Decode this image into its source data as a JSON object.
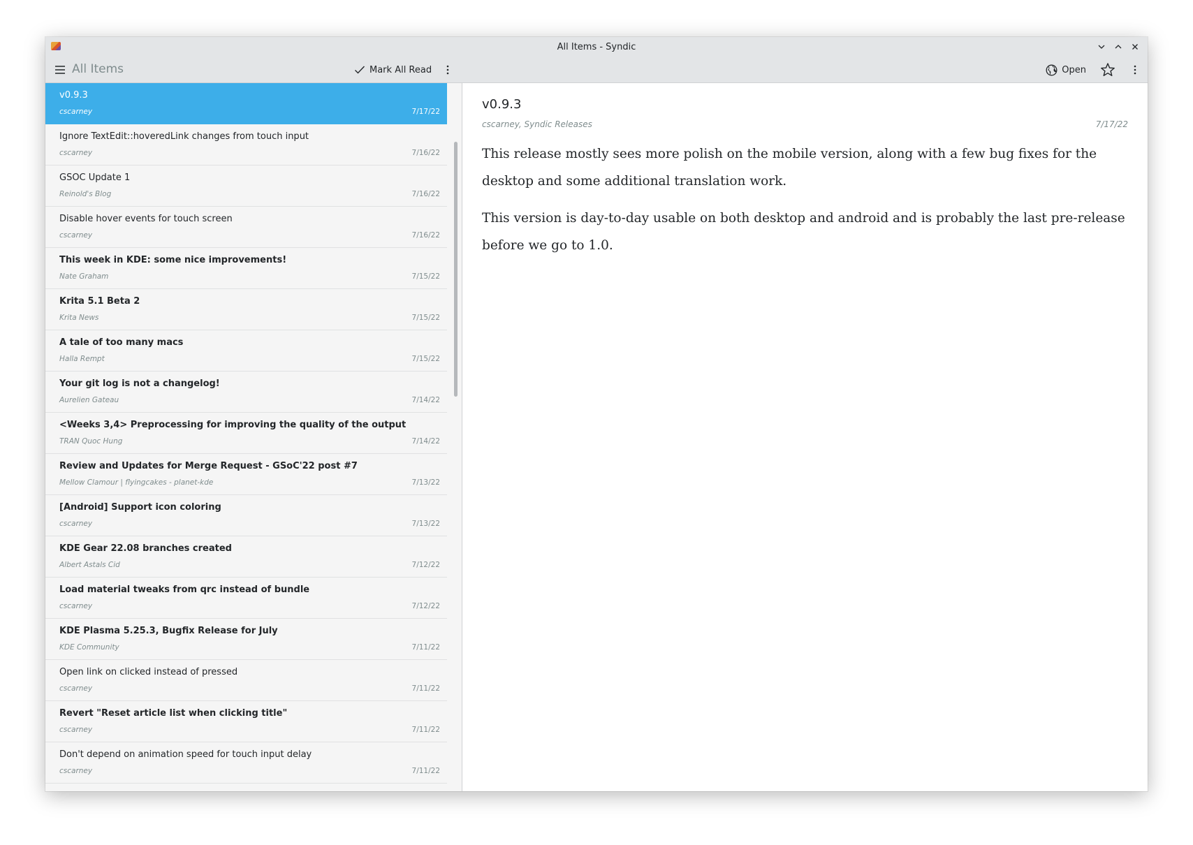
{
  "window": {
    "title": "All Items - Syndic"
  },
  "toolbar": {
    "page_title": "All Items",
    "mark_all_read_label": "Mark All Read",
    "open_label": "Open"
  },
  "list": {
    "items": [
      {
        "title": "v0.9.3",
        "author": "cscarney",
        "date": "7/17/22",
        "unread": false,
        "selected": true
      },
      {
        "title": "Ignore TextEdit::hoveredLink changes from touch input",
        "author": "cscarney",
        "date": "7/16/22",
        "unread": false
      },
      {
        "title": "GSOC Update 1",
        "author": "Reinold's Blog",
        "date": "7/16/22",
        "unread": false
      },
      {
        "title": "Disable hover events for touch screen",
        "author": "cscarney",
        "date": "7/16/22",
        "unread": false
      },
      {
        "title": "This week in KDE: some nice improvements!",
        "author": "Nate Graham",
        "date": "7/15/22",
        "unread": true
      },
      {
        "title": "Krita 5.1 Beta 2",
        "author": "Krita News",
        "date": "7/15/22",
        "unread": true
      },
      {
        "title": "A tale of too many macs",
        "author": "Halla Rempt",
        "date": "7/15/22",
        "unread": true
      },
      {
        "title": "Your git log is not a changelog!",
        "author": "Aurelien Gateau",
        "date": "7/14/22",
        "unread": true
      },
      {
        "title": "<Weeks 3,4> Preprocessing for improving the quality of the output",
        "author": "TRAN Quoc Hung",
        "date": "7/14/22",
        "unread": true
      },
      {
        "title": "Review and Updates for Merge Request - GSoC'22 post #7",
        "author": "Mellow Clamour | flyingcakes - planet-kde",
        "date": "7/13/22",
        "unread": true
      },
      {
        "title": "[Android] Support icon coloring",
        "author": "cscarney",
        "date": "7/13/22",
        "unread": true
      },
      {
        "title": "KDE Gear 22.08 branches created",
        "author": "Albert Astals Cid",
        "date": "7/12/22",
        "unread": true
      },
      {
        "title": "Load material tweaks from qrc instead of bundle",
        "author": "cscarney",
        "date": "7/12/22",
        "unread": true
      },
      {
        "title": "KDE Plasma 5.25.3, Bugfix Release for July",
        "author": "KDE Community",
        "date": "7/11/22",
        "unread": true
      },
      {
        "title": "Open link on clicked instead of pressed",
        "author": "cscarney",
        "date": "7/11/22",
        "unread": false
      },
      {
        "title": "Revert \"Reset article list when clicking title\"",
        "author": "cscarney",
        "date": "7/11/22",
        "unread": true
      },
      {
        "title": "Don't depend on animation speed for touch input delay",
        "author": "cscarney",
        "date": "7/11/22",
        "unread": false
      }
    ]
  },
  "article": {
    "title": "v0.9.3",
    "meta": "cscarney, Syndic Releases",
    "date": "7/17/22",
    "paragraphs": [
      "This release mostly sees more polish on the mobile version, along with a few bug fixes for the desktop and some additional translation work.",
      "This version is day-to-day usable on both desktop and android and is probably the last pre-release before we go to 1.0."
    ]
  },
  "colors": {
    "accent": "#3daee9",
    "text": "#232629",
    "muted": "#7f8c8d"
  }
}
